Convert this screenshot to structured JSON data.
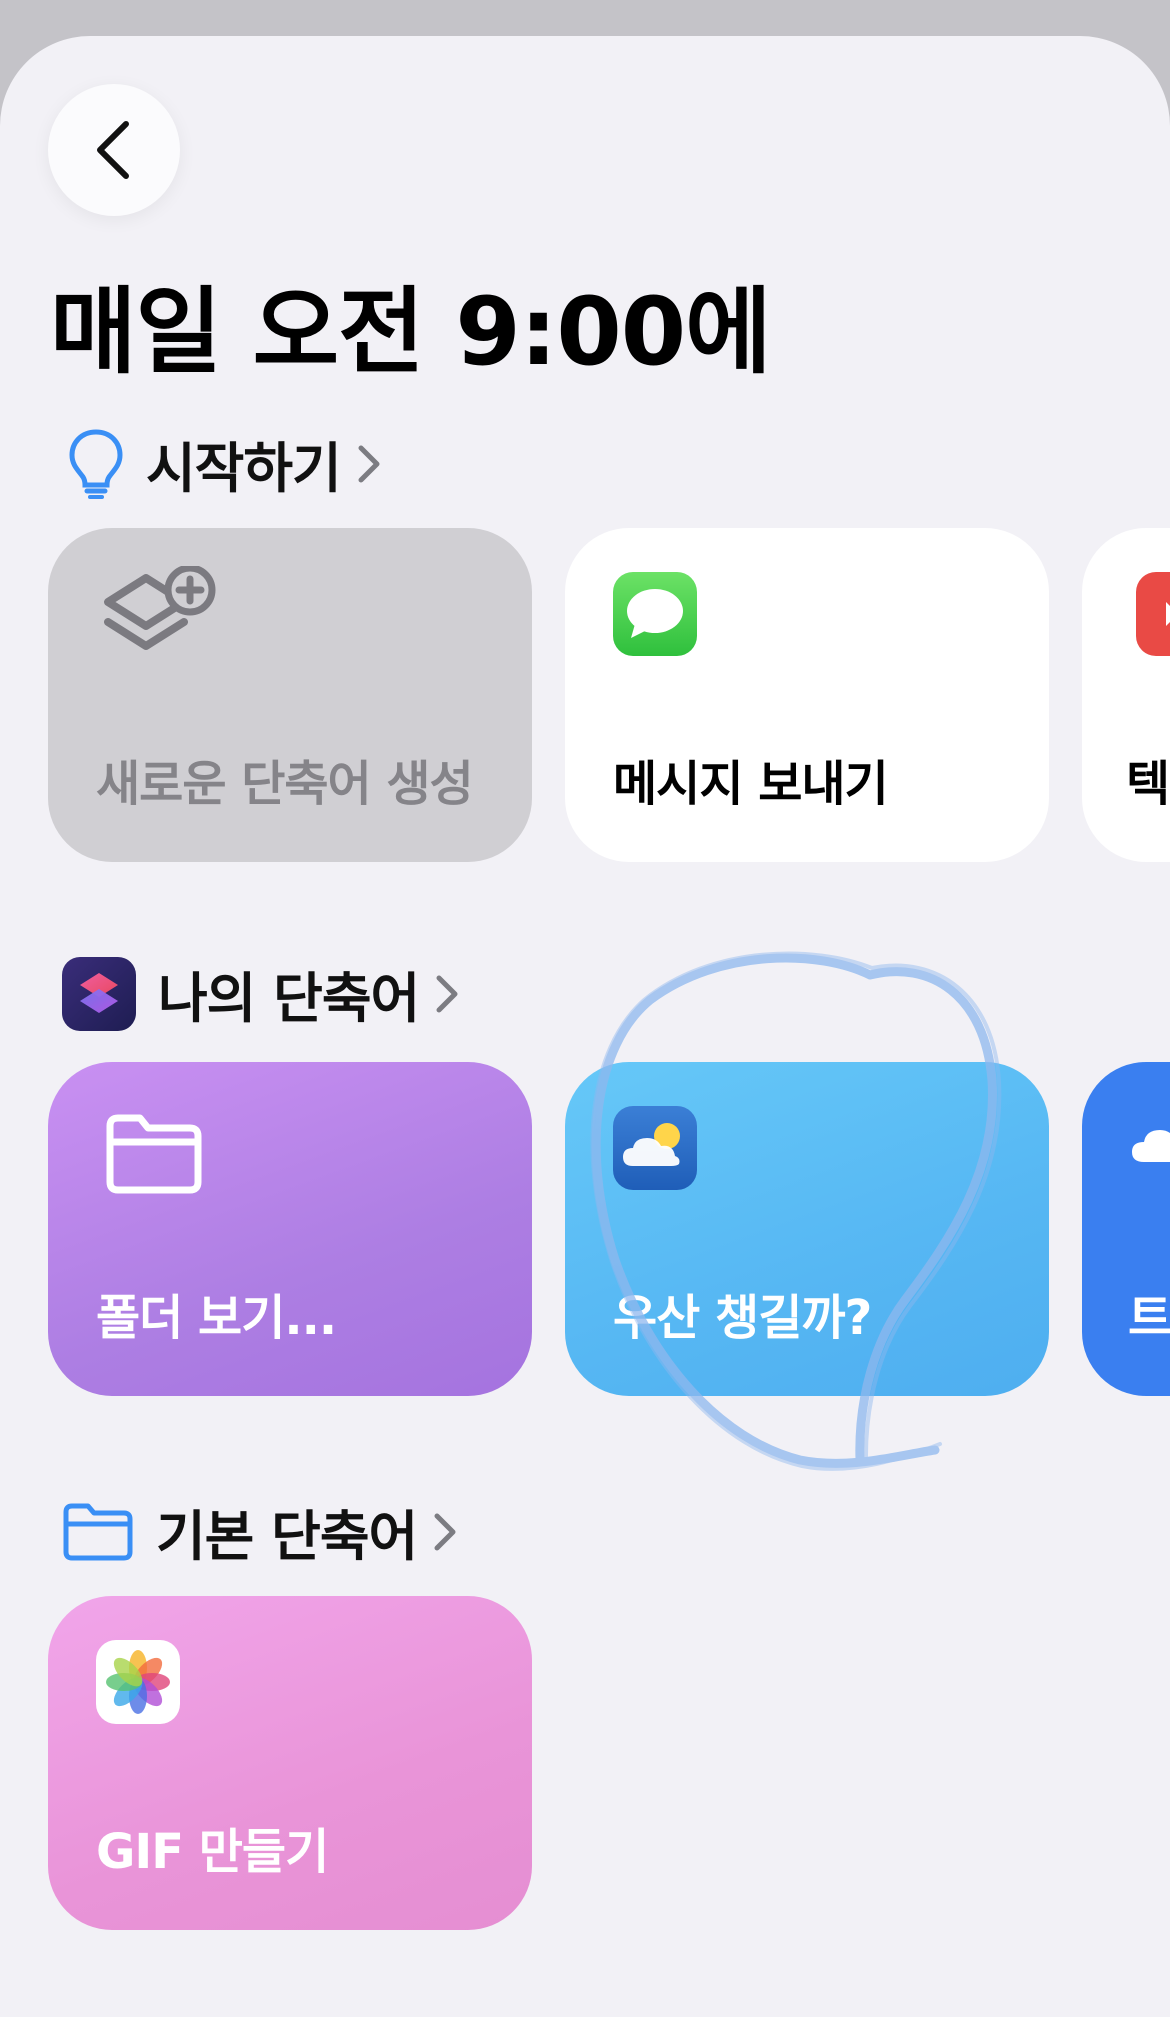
{
  "header": {
    "title": "매일 오전 9:00에"
  },
  "sections": {
    "getting_started": {
      "label": "시작하기"
    },
    "my_shortcuts": {
      "label": "나의 단축어"
    },
    "starter_shortcuts": {
      "label": "기본 단축어"
    }
  },
  "cards": {
    "new_shortcut": {
      "label": "새로운 단축어 생성"
    },
    "send_message": {
      "label": "메시지 보내기"
    },
    "partial_text": {
      "label": "텍"
    },
    "view_folder": {
      "label": "폴더 보기..."
    },
    "umbrella": {
      "label": "우산 챙길까?"
    },
    "partial_blue": {
      "label": "트"
    },
    "make_gif": {
      "label": "GIF 만들기"
    }
  },
  "icons": {
    "back": "chevron-left-icon",
    "bulb": "lightbulb-icon",
    "shortcuts_app": "shortcuts-app-icon",
    "folder": "folder-icon",
    "new_shortcut": "layers-plus-icon",
    "messages": "messages-app-icon",
    "weather": "weather-app-icon",
    "photos": "photos-app-icon"
  },
  "colors": {
    "background": "#f2f1f6",
    "accent_blue": "#3a8ff5",
    "card_gray": "#d0cfd3",
    "card_purple": "#b180e4",
    "card_sky": "#5bbbf4",
    "card_pink": "#ec9bdc"
  }
}
